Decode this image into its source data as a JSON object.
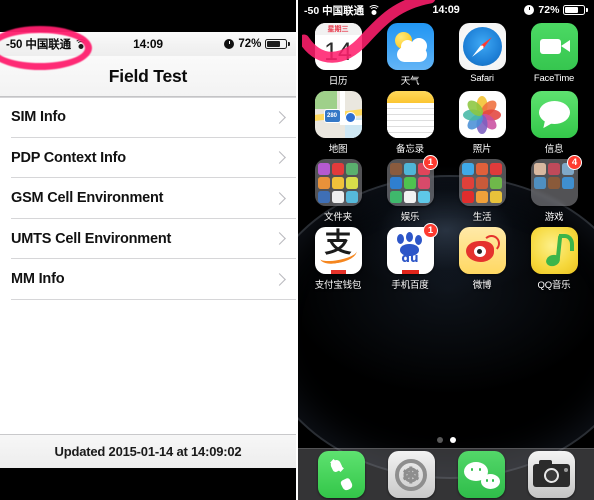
{
  "left_panel": {
    "status_bar": {
      "signal_text": "-50 中国联通",
      "wifi_icon": "wifi-icon",
      "time": "14:09",
      "alarm_icon": "alarm-clock-icon",
      "battery_percent": "72%",
      "battery_level": 72,
      "battery_icon": "battery-icon"
    },
    "nav_title": "Field Test",
    "list_items": [
      {
        "label": "SIM Info",
        "accessory": "chevron-right-icon"
      },
      {
        "label": "PDP Context Info",
        "accessory": "chevron-right-icon"
      },
      {
        "label": "GSM Cell Environment",
        "accessory": "chevron-right-icon"
      },
      {
        "label": "UMTS Cell Environment",
        "accessory": "chevron-right-icon"
      },
      {
        "label": "MM Info",
        "accessory": "chevron-right-icon"
      }
    ],
    "footer_text": "Updated 2015-01-14 at 14:09:02",
    "annotation": {
      "type": "circle",
      "color": "#ff1f6e",
      "target": "signal-strength-readout"
    }
  },
  "right_panel": {
    "status_bar": {
      "signal_text": "-50 中国联通",
      "wifi_icon": "wifi-icon",
      "time": "14:09",
      "alarm_icon": "alarm-clock-icon",
      "battery_percent": "72%",
      "battery_level": 72,
      "battery_icon": "battery-icon"
    },
    "annotation": {
      "type": "check-swoosh",
      "color": "#ff1f6e",
      "target": "calendar-app-icon"
    },
    "calendar_icon": {
      "weekday": "星期三",
      "day": "14"
    },
    "home_rows": [
      [
        {
          "label": "日历",
          "icon": "calendar-app-icon",
          "badge": null
        },
        {
          "label": "天气",
          "icon": "weather-app-icon",
          "badge": null
        },
        {
          "label": "Safari",
          "icon": "safari-app-icon",
          "badge": null
        },
        {
          "label": "FaceTime",
          "icon": "facetime-app-icon",
          "badge": null
        }
      ],
      [
        {
          "label": "地图",
          "icon": "maps-app-icon",
          "badge": null
        },
        {
          "label": "备忘录",
          "icon": "notes-app-icon",
          "badge": null
        },
        {
          "label": "照片",
          "icon": "photos-app-icon",
          "badge": null
        },
        {
          "label": "信息",
          "icon": "messages-app-icon",
          "badge": null
        }
      ],
      [
        {
          "label": "文件夹",
          "icon": "folder-icon",
          "badge": null
        },
        {
          "label": "娱乐",
          "icon": "folder-icon",
          "badge": "1"
        },
        {
          "label": "生活",
          "icon": "folder-icon",
          "badge": null
        },
        {
          "label": "游戏",
          "icon": "folder-icon",
          "badge": "4"
        }
      ],
      [
        {
          "label": "支付宝钱包",
          "icon": "alipay-app-icon",
          "badge": null
        },
        {
          "label": "手机百度",
          "icon": "baidu-app-icon",
          "badge": "1"
        },
        {
          "label": "微博",
          "icon": "weibo-app-icon",
          "badge": null
        },
        {
          "label": "QQ音乐",
          "icon": "qqmusic-app-icon",
          "badge": null
        }
      ]
    ],
    "page_dots": {
      "count": 2,
      "active_index": 1
    },
    "dock": [
      {
        "label": "电话",
        "icon": "phone-app-icon"
      },
      {
        "label": "设置",
        "icon": "settings-app-icon"
      },
      {
        "label": "微信",
        "icon": "wechat-app-icon"
      },
      {
        "label": "相机",
        "icon": "camera-app-icon"
      }
    ]
  },
  "colors": {
    "annotation_pink": "#ff1f6e",
    "badge_red": "#ff3b30",
    "ios_green": "#4cd964",
    "ios_blue": "#2196f3"
  }
}
